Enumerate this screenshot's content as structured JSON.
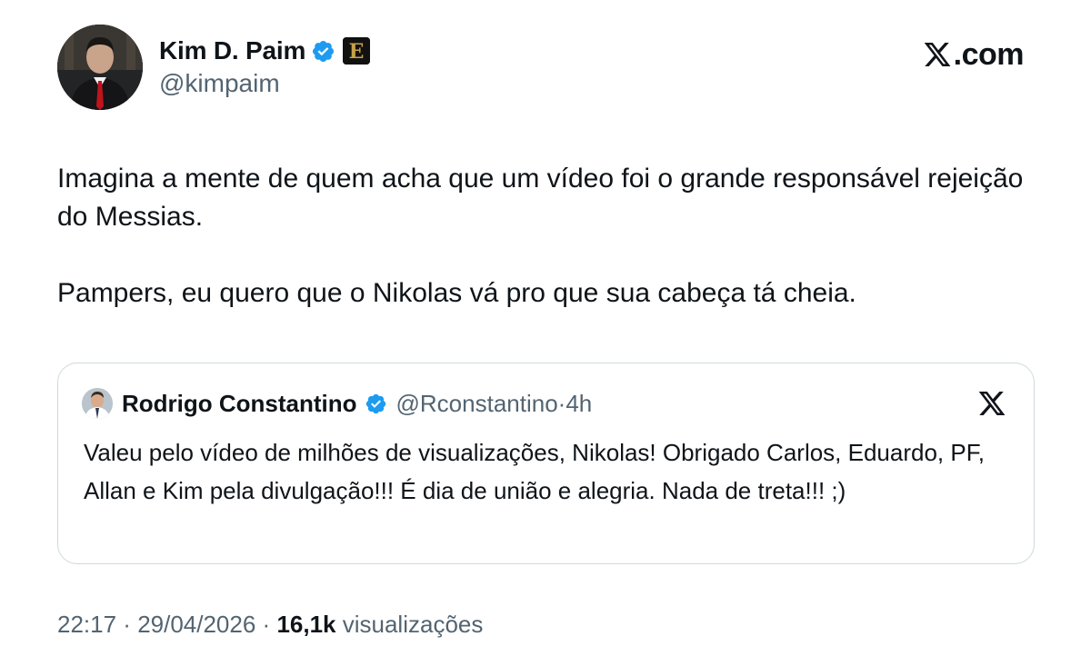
{
  "author": {
    "display_name": "Kim D. Paim",
    "handle": "@kimpaim",
    "verified": true,
    "affiliate_badge_letter": "E",
    "avatar_icon": "profile-photo-man-in-suit"
  },
  "brand": {
    "label": ".com"
  },
  "tweet": {
    "paragraphs": [
      "Imagina a mente de quem acha que um vídeo foi o grande responsável rejeição do Messias.",
      "Pampers, eu quero que o Nikolas vá pro que sua cabeça tá cheia."
    ]
  },
  "quoted_tweet": {
    "display_name": "Rodrigo Constantino",
    "handle": "@Rconstantino",
    "separator": "·",
    "time_ago": "4h",
    "text": "Valeu pelo vídeo de milhões de visualizações, Nikolas! Obrigado Carlos, Eduardo, PF, Allan e Kim pela divulgação!!! É dia de união e alegria. Nada de treta!!! ;)",
    "source_icon": "x-logo-icon"
  },
  "meta": {
    "time": "22:17",
    "separator": " · ",
    "date": "29/04/2026",
    "views_count": "16,1k",
    "views_label": " visualizações"
  },
  "colors": {
    "text": "#0f1419",
    "secondary": "#536471",
    "verified": "#1d9bf0",
    "border": "#cfd9de"
  }
}
